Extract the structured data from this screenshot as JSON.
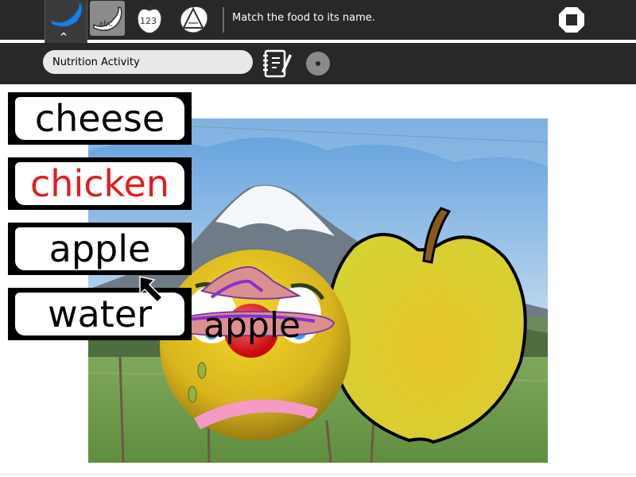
{
  "toolbar": {
    "activity_icon": "banana-icon",
    "tools": [
      {
        "name": "abc-banana-icon",
        "active": true
      },
      {
        "name": "123-apple-icon",
        "active": false
      },
      {
        "name": "triangle-shape-icon",
        "active": false
      }
    ],
    "instruction": "Match the food to its name.",
    "stop_icon": "stop-icon"
  },
  "activity_bar": {
    "title_value": "Nutrition Activity",
    "journal_icon": "journal-icon",
    "share_icon": "share-icon"
  },
  "game": {
    "words": [
      "cheese",
      "chicken",
      "apple",
      "water"
    ],
    "hovered_word": "chicken",
    "face_label": "apple",
    "colors": {
      "hover": "#e21d1d",
      "apple": "#d8d22a",
      "face": "#e8c21a"
    }
  }
}
